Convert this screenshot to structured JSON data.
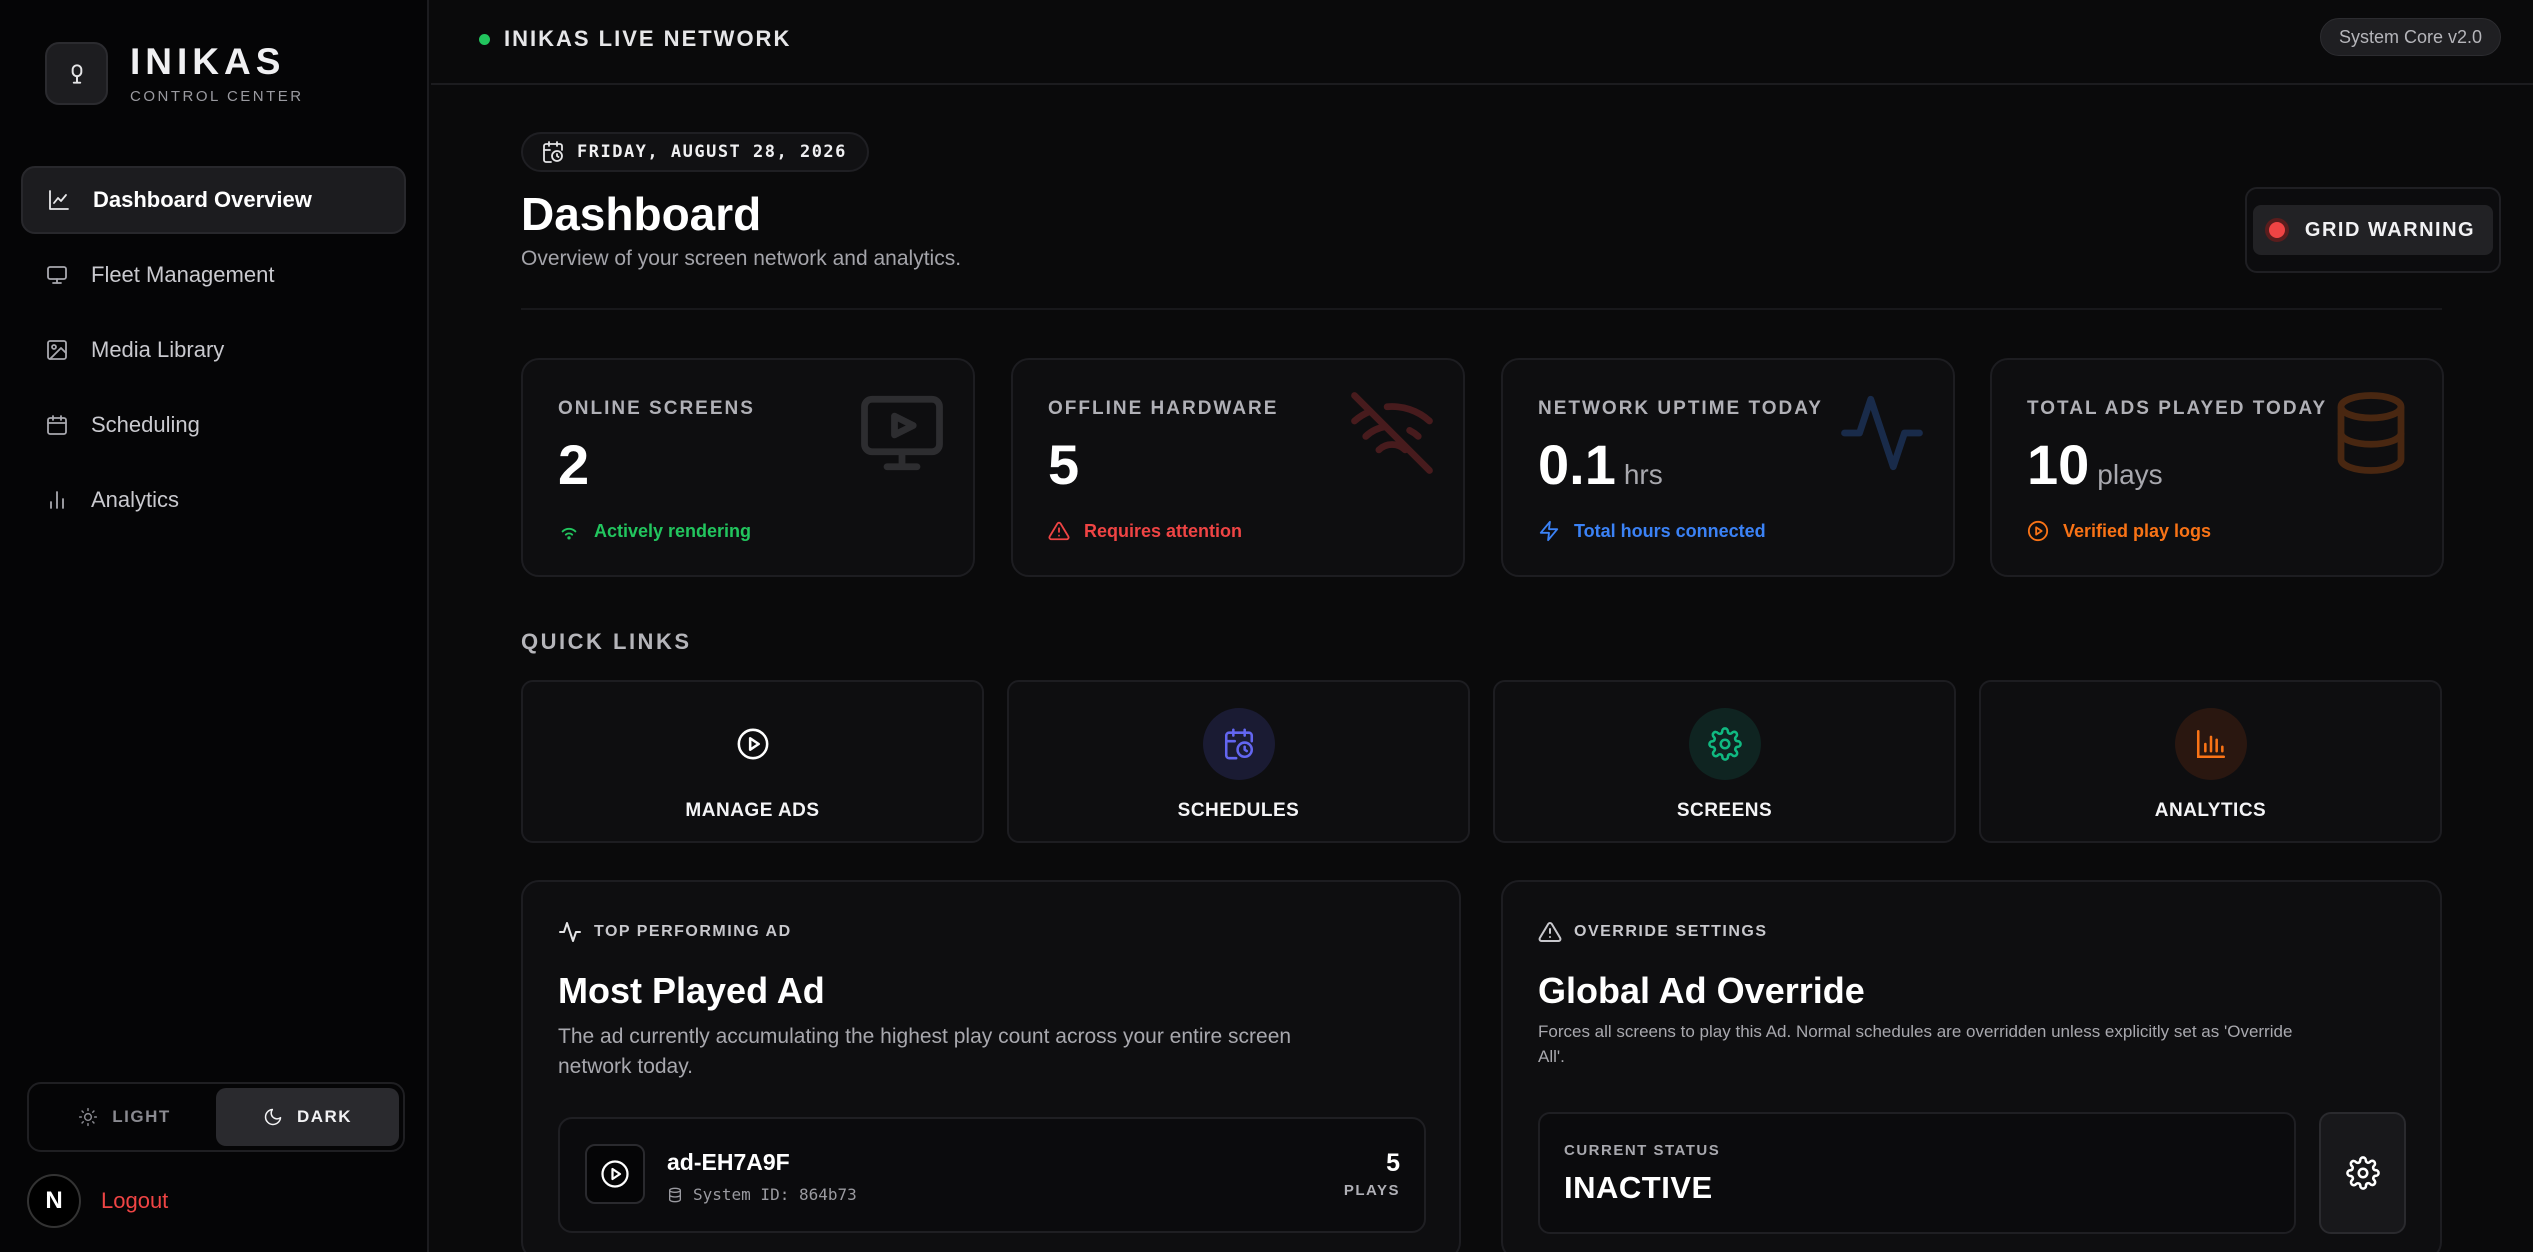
{
  "brand": {
    "name": "INIKAS",
    "subtitle": "CONTROL CENTER"
  },
  "sidebar": {
    "items": [
      {
        "label": "Dashboard Overview",
        "icon": "chart-line-icon",
        "active": true
      },
      {
        "label": "Fleet Management",
        "icon": "monitor-icon"
      },
      {
        "label": "Media Library",
        "icon": "image-icon"
      },
      {
        "label": "Scheduling",
        "icon": "calendar-icon"
      },
      {
        "label": "Analytics",
        "icon": "bar-chart-icon"
      }
    ],
    "theme": {
      "light": "LIGHT",
      "dark": "DARK",
      "selected": "DARK"
    },
    "avatar_initial": "N",
    "logout": "Logout"
  },
  "topbar": {
    "network": "INIKAS LIVE NETWORK",
    "version": "System Core v2.0"
  },
  "header": {
    "date": "FRIDAY, AUGUST 28, 2026",
    "title": "Dashboard",
    "subtitle": "Overview of your screen network and analytics.",
    "warning": "GRID WARNING"
  },
  "stats": [
    {
      "label": "ONLINE SCREENS",
      "value": "2",
      "unit": "",
      "note": "Actively rendering",
      "color": "#22c55e",
      "icon": "monitor-play-icon"
    },
    {
      "label": "OFFLINE HARDWARE",
      "value": "5",
      "unit": "",
      "note": "Requires attention",
      "color": "#ef4444",
      "icon": "wifi-off-icon"
    },
    {
      "label": "NETWORK UPTIME TODAY",
      "value": "0.1",
      "unit": "hrs",
      "note": "Total hours connected",
      "color": "#3b82f6",
      "icon": "activity-icon"
    },
    {
      "label": "TOTAL ADS PLAYED TODAY",
      "value": "10",
      "unit": "plays",
      "note": "Verified play logs",
      "color": "#f97316",
      "icon": "database-icon"
    }
  ],
  "quick_links": {
    "title": "QUICK LINKS",
    "items": [
      {
        "label": "MANAGE ADS",
        "icon": "play-circle-icon",
        "color": "#ffffff"
      },
      {
        "label": "SCHEDULES",
        "icon": "calendar-clock-icon",
        "color": "#6366f1"
      },
      {
        "label": "SCREENS",
        "icon": "gear-icon",
        "color": "#10b981"
      },
      {
        "label": "ANALYTICS",
        "icon": "bar-chart-icon",
        "color": "#f97316"
      }
    ]
  },
  "top_ad": {
    "kicker": "TOP PERFORMING AD",
    "title": "Most Played Ad",
    "description": "The ad currently accumulating the highest play count across your entire screen network today.",
    "ad_name": "ad-EH7A9F",
    "system_id": "System ID: 864b73",
    "plays": "5",
    "plays_label": "PLAYS"
  },
  "override": {
    "kicker": "OVERRIDE SETTINGS",
    "title": "Global Ad Override",
    "description": "Forces all screens to play this Ad. Normal schedules are overridden unless explicitly set as 'Override All'.",
    "status_label": "CURRENT STATUS",
    "status_value": "INACTIVE"
  }
}
